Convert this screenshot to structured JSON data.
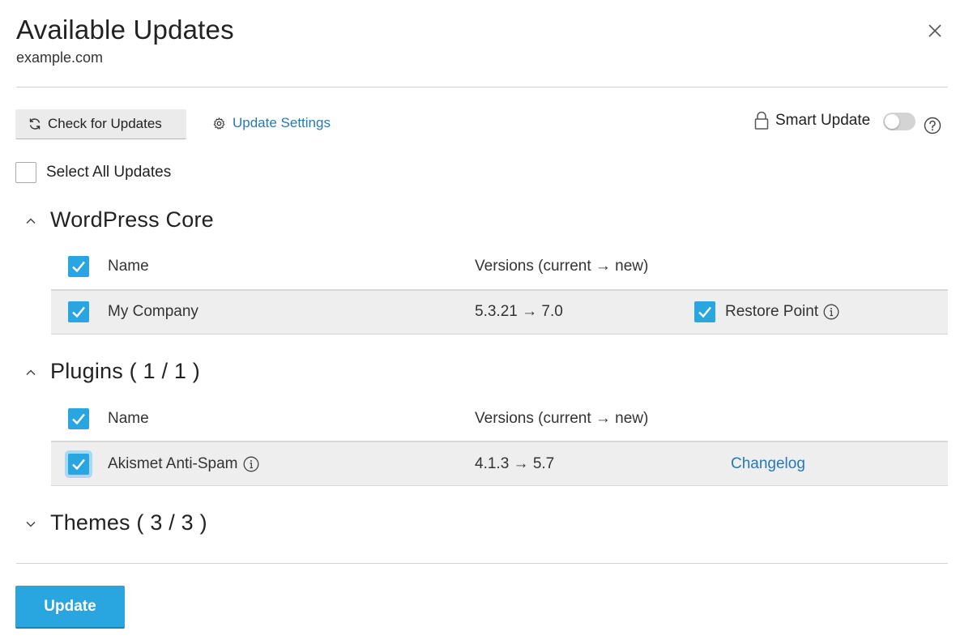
{
  "header": {
    "title": "Available Updates",
    "subtitle": "example.com"
  },
  "toolbar": {
    "check_label": "Check for Updates",
    "settings_label": "Update Settings",
    "smart_update_label": "Smart Update",
    "smart_update_enabled": false
  },
  "select_all": {
    "label": "Select All Updates",
    "checked": false
  },
  "sections": [
    {
      "title": "WordPress Core",
      "expanded": true,
      "columns": [
        "Name",
        "Versions (current → new)"
      ],
      "rows": [
        {
          "name": "My Company",
          "versions": "5.3.21 → 7.0",
          "checked": true,
          "extra_label": "Restore Point",
          "extra_checked": true
        }
      ]
    },
    {
      "title": "Plugins ( 1 / 1 )",
      "expanded": true,
      "columns": [
        "Name",
        "Versions (current → new)"
      ],
      "rows": [
        {
          "name": "Akismet Anti-Spam",
          "versions": "4.1.3 → 5.7",
          "checked": true,
          "link_label": "Changelog"
        }
      ]
    },
    {
      "title": "Themes ( 3 / 3 )",
      "expanded": false
    }
  ],
  "footer": {
    "update_label": "Update"
  },
  "colors": {
    "accent": "#29a5e0",
    "link": "#2878b4",
    "row_background": "#eeeeee"
  }
}
